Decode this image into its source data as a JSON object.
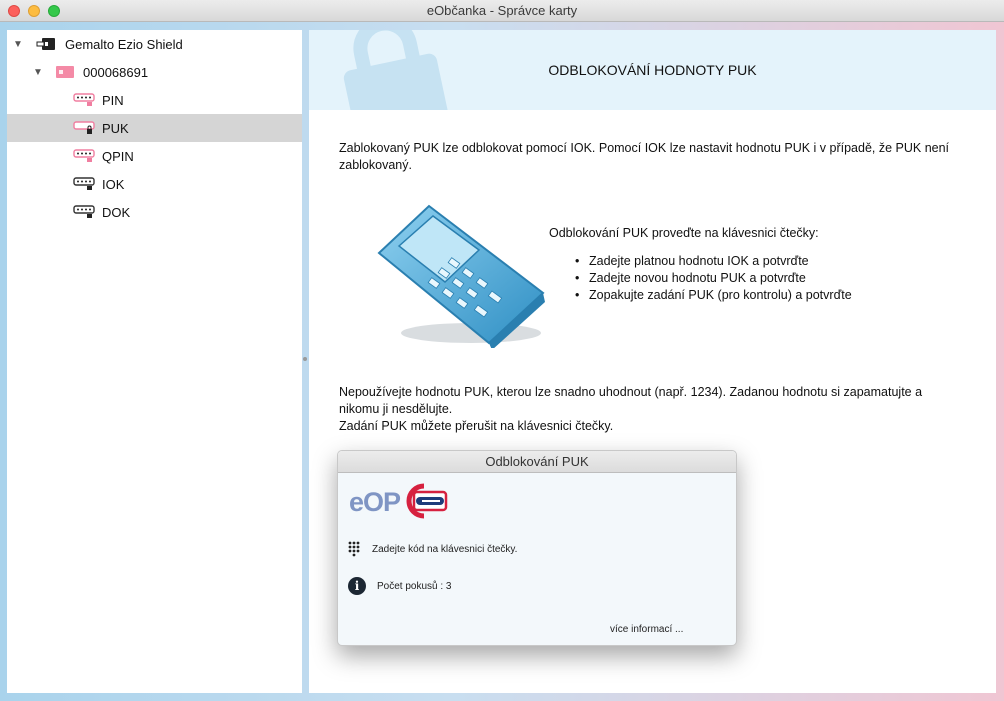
{
  "window": {
    "title": "eObčanka - Správce karty"
  },
  "sidebar": {
    "reader": "Gemalto Ezio Shield",
    "card": "000068691",
    "items": [
      {
        "label": "PIN",
        "icon": "pin-key-icon"
      },
      {
        "label": "PUK",
        "icon": "puk-lock-key-icon",
        "selected": true
      },
      {
        "label": "QPIN",
        "icon": "qpin-key-icon"
      },
      {
        "label": "IOK",
        "icon": "iok-key-icon"
      },
      {
        "label": "DOK",
        "icon": "dok-key-icon"
      }
    ]
  },
  "main": {
    "title": "ODBLOKOVÁNÍ HODNOTY PUK",
    "intro": "Zablokovaný PUK lze odblokovat pomocí IOK. Pomocí IOK lze nastavit hodnotu PUK i v případě, že PUK není zablokovaný.",
    "steps_title": "Odblokování PUK proveďte na klávesnici čtečky:",
    "steps": [
      "Zadejte platnou hodnotu IOK a potvrďte",
      "Zadejte novou hodnotu PUK a potvrďte",
      "Zopakujte zadání PUK (pro kontrolu) a potvrďte"
    ],
    "warning_line1": "Nepoužívejte hodnotu PUK, kterou lze snadno uhodnout (např. 1234). Zadanou hodnotu si zapamatujte a nikomu ji nesdělujte.",
    "warning_line2": "Zadání PUK můžete přerušit na klávesnici čtečky."
  },
  "dialog": {
    "title": "Odblokování PUK",
    "logo_text": "eOP",
    "instruction": "Zadejte kód na klávesnici čtečky.",
    "attempts": "Počet pokusů : 3",
    "more_info": "více informací ..."
  },
  "colors": {
    "banner_bg": "#e4f3fb",
    "selection": "#d5d5d5",
    "logo_blue": "#7f95c4",
    "logo_red": "#d6213f",
    "logo_navy": "#1f3c7a",
    "terminal_blue": "#4aa8d8"
  }
}
